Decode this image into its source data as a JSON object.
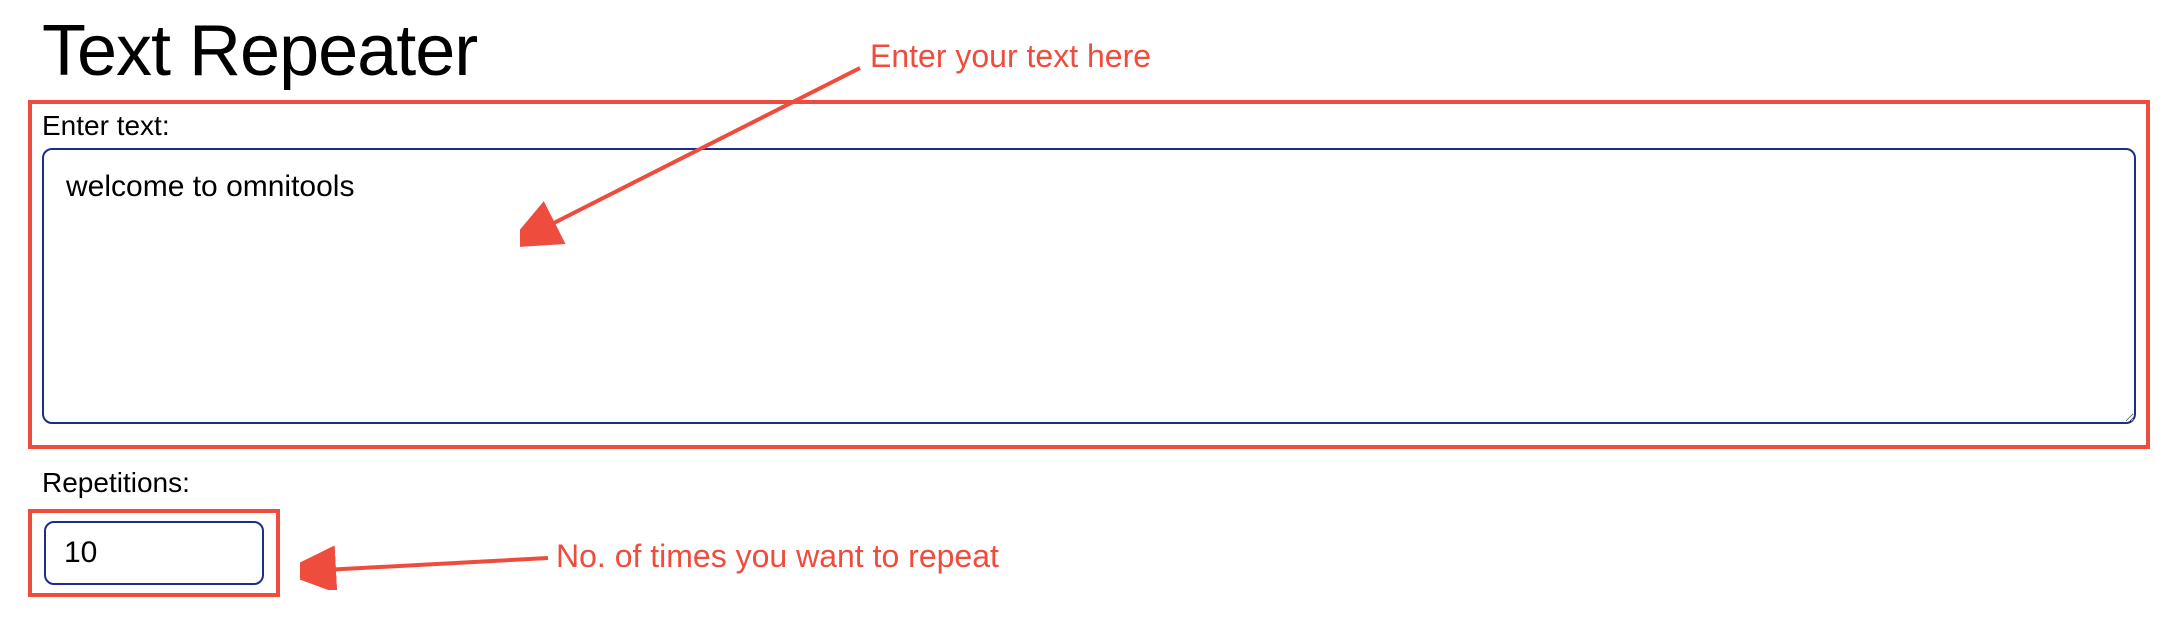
{
  "page": {
    "title": "Text Repeater"
  },
  "textField": {
    "label": "Enter text:",
    "value": "welcome to omnitools"
  },
  "repsField": {
    "label": "Repetitions:",
    "value": "10"
  },
  "annotations": {
    "textHint": "Enter your text here",
    "repsHint": "No. of times you want to repeat"
  },
  "colors": {
    "highlight": "#ee4c3c",
    "inputBorder": "#1a2f8c"
  }
}
